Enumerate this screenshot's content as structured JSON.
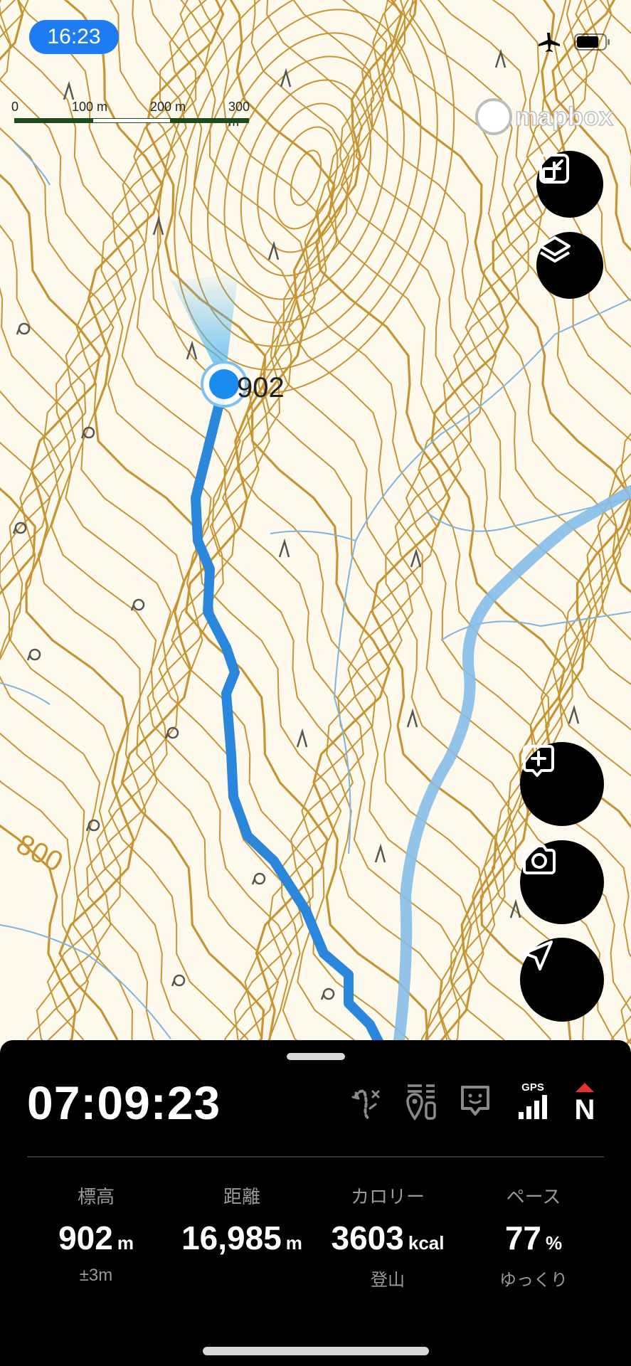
{
  "status": {
    "time": "16:23",
    "icons": [
      "airplane-icon",
      "battery-icon"
    ]
  },
  "map": {
    "attribution": "mapbox",
    "scale_labels": [
      "0",
      "100 m",
      "200 m",
      "300 m"
    ],
    "elevation_label": "902",
    "contour_label": "800",
    "colors": {
      "contour": "#c89432",
      "river": "#7fb3e0",
      "track": "#2a87dc",
      "background": "#fdf9ec",
      "location": "#1a8cf0"
    }
  },
  "map_controls": {
    "fit_button": "fit-bounds-icon",
    "layers_button": "layers-icon",
    "add_note_button": "add-note-icon",
    "camera_button": "camera-icon",
    "locate_button": "navigation-icon"
  },
  "panel": {
    "elapsed_time": "07:09:23",
    "indicators": {
      "gps_label": "GPS",
      "compass_label": "N"
    },
    "stats": {
      "elevation": {
        "label": "標高",
        "value": "902",
        "unit": "m",
        "sub": "±3m"
      },
      "distance": {
        "label": "距離",
        "value": "16,985",
        "unit": "m",
        "sub": ""
      },
      "calories": {
        "label": "カロリー",
        "value": "3603",
        "unit": "kcal",
        "sub": "登山"
      },
      "pace": {
        "label": "ペース",
        "value": "77",
        "unit": "%",
        "sub": "ゆっくり"
      }
    }
  }
}
